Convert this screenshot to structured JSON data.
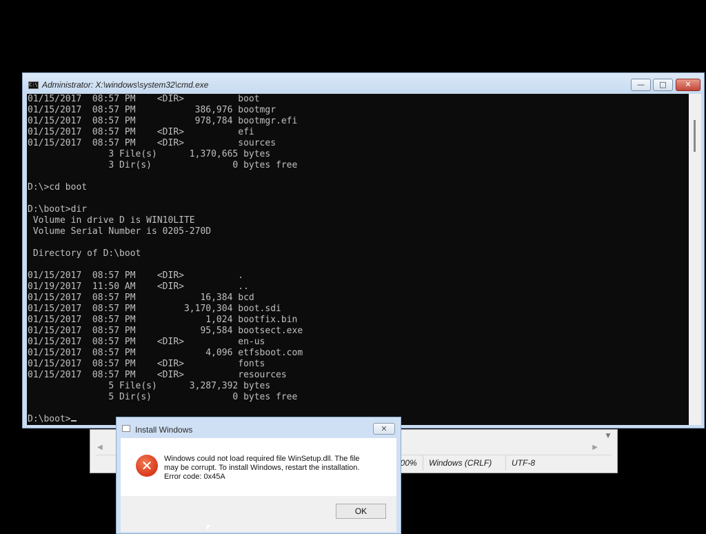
{
  "notepad": {
    "statusbar": {
      "zoom": "100%",
      "line_ending": "Windows (CRLF)",
      "encoding": "UTF-8"
    }
  },
  "cmd": {
    "title": "Administrator: X:\\windows\\system32\\cmd.exe",
    "buttons": {
      "minimize": "—",
      "maximize": "□",
      "close": "✕"
    },
    "lines": [
      "01/15/2017  08:57 PM    <DIR>          boot",
      "01/15/2017  08:57 PM           386,976 bootmgr",
      "01/15/2017  08:57 PM           978,784 bootmgr.efi",
      "01/15/2017  08:57 PM    <DIR>          efi",
      "01/15/2017  08:57 PM    <DIR>          sources",
      "               3 File(s)      1,370,665 bytes",
      "               3 Dir(s)               0 bytes free",
      "",
      "D:\\>cd boot",
      "",
      "D:\\boot>dir",
      " Volume in drive D is WIN10LITE",
      " Volume Serial Number is 0205-270D",
      "",
      " Directory of D:\\boot",
      "",
      "01/15/2017  08:57 PM    <DIR>          .",
      "01/19/2017  11:50 AM    <DIR>          ..",
      "01/15/2017  08:57 PM            16,384 bcd",
      "01/15/2017  08:57 PM         3,170,304 boot.sdi",
      "01/15/2017  08:57 PM             1,024 bootfix.bin",
      "01/15/2017  08:57 PM            95,584 bootsect.exe",
      "01/15/2017  08:57 PM    <DIR>          en-us",
      "01/15/2017  08:57 PM             4,096 etfsboot.com",
      "01/15/2017  08:57 PM    <DIR>          fonts",
      "01/15/2017  08:57 PM    <DIR>          resources",
      "               5 File(s)      3,287,392 bytes",
      "               5 Dir(s)               0 bytes free",
      "",
      "D:\\boot>"
    ]
  },
  "dialog": {
    "title": "Install Windows",
    "close": "✕",
    "message_line1": "Windows could not load required file WinSetup.dll. The file",
    "message_line2": "may be corrupt. To install Windows, restart the installation.",
    "message_line3": "Error code: 0x45A",
    "ok_label": "OK",
    "icon_glyph": "✕"
  }
}
